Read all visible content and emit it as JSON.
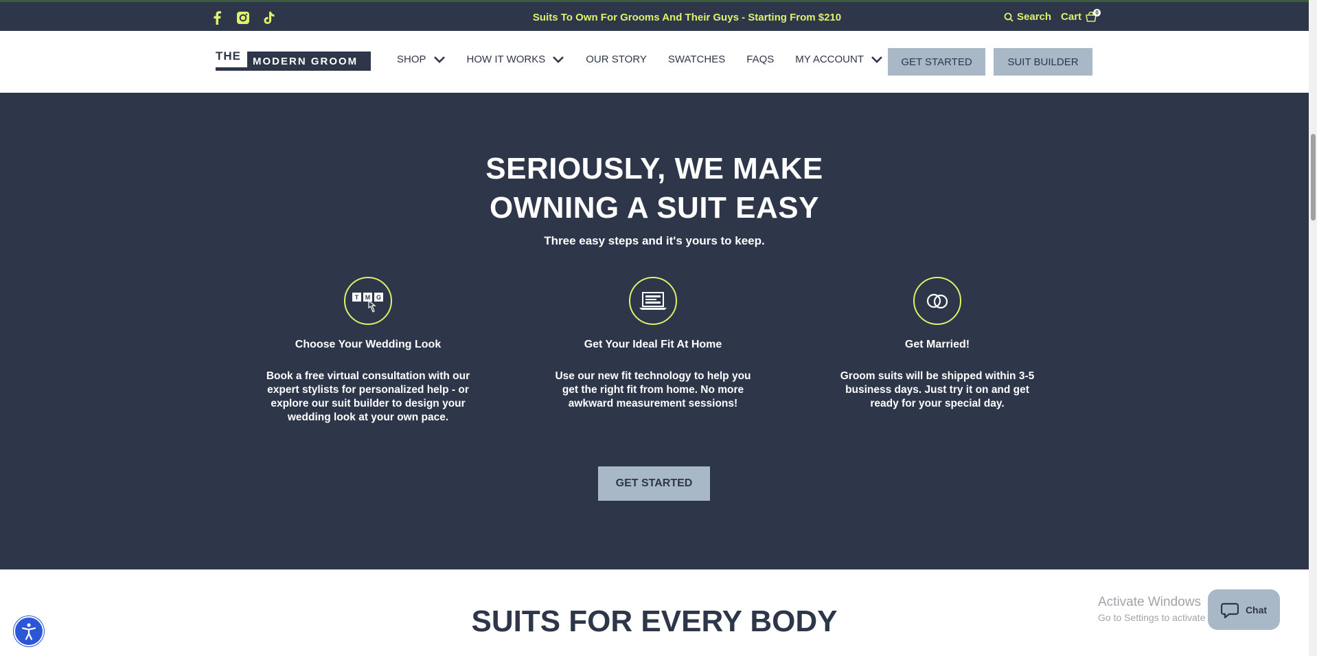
{
  "topbar": {
    "social": [
      "facebook-icon",
      "instagram-icon",
      "tiktok-icon"
    ],
    "announcement": "Suits To Own For Grooms And Their Guys - Starting From $210",
    "search_label": "Search",
    "cart_label": "Cart",
    "cart_count": "0"
  },
  "header": {
    "logo_the": "THE",
    "logo_brand": "MODERN GROOM",
    "nav": [
      {
        "label": "SHOP",
        "has_dropdown": true
      },
      {
        "label": "HOW IT WORKS",
        "has_dropdown": true
      },
      {
        "label": "OUR STORY",
        "has_dropdown": false
      },
      {
        "label": "SWATCHES",
        "has_dropdown": false
      },
      {
        "label": "FAQS",
        "has_dropdown": false
      },
      {
        "label": "MY ACCOUNT",
        "has_dropdown": true
      }
    ],
    "get_started": "GET STARTED",
    "suit_builder": "SUIT BUILDER"
  },
  "hero": {
    "title_line1": "SERIOUSLY, WE MAKE",
    "title_line2": "OWNING A SUIT EASY",
    "subtitle": "Three easy steps and it's yours to keep.",
    "steps": [
      {
        "icon": "tmg-keys-icon",
        "title": "Choose Your Wedding Look",
        "desc": "Book a free virtual consultation with our expert stylists for personalized help - or explore our suit builder to design your wedding look at your own pace."
      },
      {
        "icon": "laptop-icon",
        "title": "Get Your Ideal Fit At Home",
        "desc": "Use our new fit technology to help you get the right fit from home. No more awkward measurement sessions!"
      },
      {
        "icon": "rings-icon",
        "title": "Get Married!",
        "desc": "Groom suits will be shipped within 3-5 business days. Just try it on and get ready for your special day."
      }
    ],
    "cta": "GET STARTED"
  },
  "bottom": {
    "title": "SUITS FOR EVERY BODY"
  },
  "widgets": {
    "chat_label": "Chat",
    "activate_line1": "Activate Windows",
    "activate_line2": "Go to Settings to activate Windows."
  },
  "colors": {
    "navy": "#2e3649",
    "accent": "#dff26b",
    "button": "#a9b8c7",
    "accessibility": "#2b56d6"
  }
}
